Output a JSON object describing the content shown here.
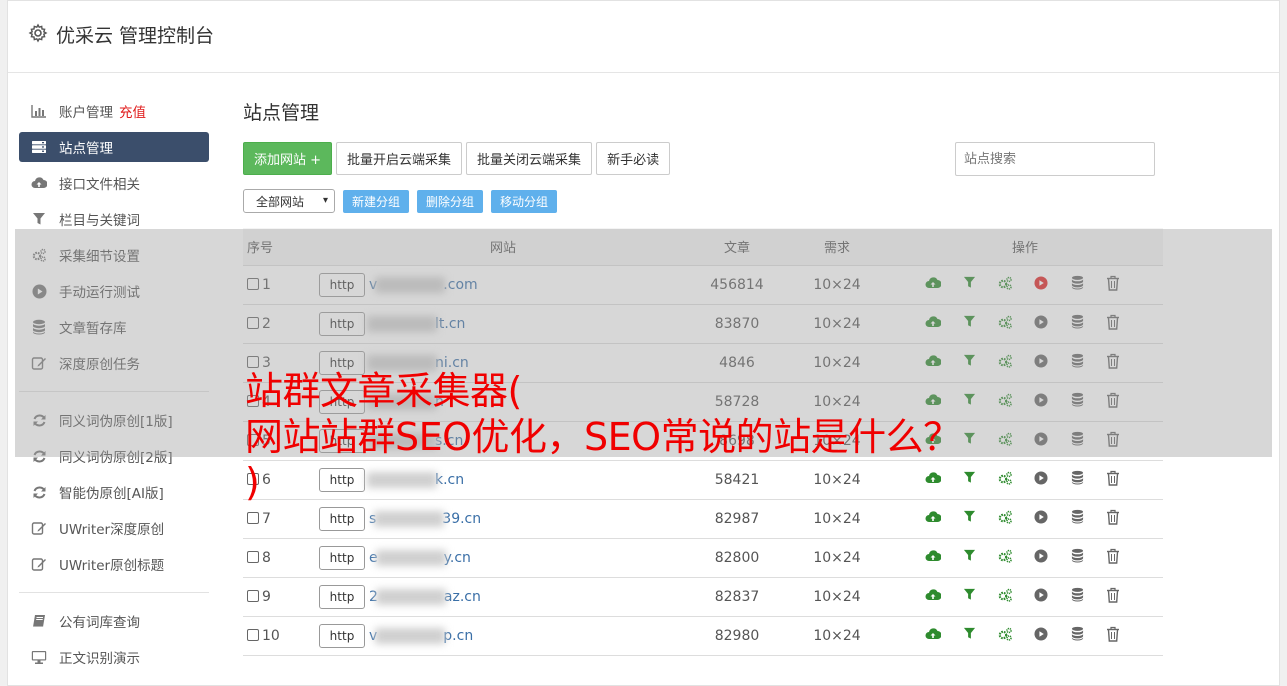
{
  "header": {
    "title": "优采云 管理控制台",
    "icon": "gear-icon"
  },
  "sidebar": {
    "groups": [
      [
        {
          "label": "账户管理",
          "badge": "充值",
          "icon": "bar-chart-icon"
        },
        {
          "label": "站点管理",
          "icon": "server-icon",
          "active": true
        },
        {
          "label": "接口文件相关",
          "icon": "cloud-upload-icon"
        },
        {
          "label": "栏目与关键词",
          "icon": "filter-icon"
        },
        {
          "label": "采集细节设置",
          "icon": "gears-icon"
        },
        {
          "label": "手动运行测试",
          "icon": "play-circle-icon"
        },
        {
          "label": "文章暂存库",
          "icon": "database-icon"
        },
        {
          "label": "深度原创任务",
          "icon": "edit-icon"
        }
      ],
      [
        {
          "label": "同义词伪原创[1版]",
          "icon": "refresh-icon"
        },
        {
          "label": "同义词伪原创[2版]",
          "icon": "refresh-icon"
        },
        {
          "label": "智能伪原创[AI版]",
          "icon": "refresh-icon"
        },
        {
          "label": "UWriter深度原创",
          "icon": "edit-icon"
        },
        {
          "label": "UWriter原创标题",
          "icon": "edit-icon"
        }
      ],
      [
        {
          "label": "公有词库查询",
          "icon": "book-icon"
        },
        {
          "label": "正文识别演示",
          "icon": "monitor-icon"
        }
      ]
    ]
  },
  "main": {
    "title": "站点管理",
    "buttons": {
      "add": "添加网站 +",
      "batch_open": "批量开启云端采集",
      "batch_close": "批量关闭云端采集",
      "guide": "新手必读"
    },
    "search_placeholder": "站点搜索",
    "group_select": "全部网站",
    "group_buttons": {
      "new": "新建分组",
      "delete": "删除分组",
      "move": "移动分组"
    },
    "table": {
      "headers": {
        "no": "序号",
        "site": "网站",
        "articles": "文章",
        "demand": "需求",
        "ops": "操作"
      },
      "http_label": "http",
      "rows": [
        {
          "no": "1",
          "pre": "v",
          "post": ".com",
          "articles": "456814",
          "demand": "10×24",
          "play_red": true
        },
        {
          "no": "2",
          "pre": "",
          "post": "lt.cn",
          "articles": "83870",
          "demand": "10×24",
          "play_red": false
        },
        {
          "no": "3",
          "pre": "",
          "post": "ni.cn",
          "articles": "4846",
          "demand": "10×24",
          "play_red": false
        },
        {
          "no": "4",
          "pre": "",
          "post": "n",
          "articles": "58728",
          "demand": "10×24",
          "play_red": false
        },
        {
          "no": "5",
          "pre": "",
          "post": "s.cn",
          "articles": "8698",
          "demand": "10×24",
          "play_red": false
        },
        {
          "no": "6",
          "pre": "",
          "post": "k.cn",
          "articles": "58421",
          "demand": "10×24",
          "play_red": false
        },
        {
          "no": "7",
          "pre": "s",
          "post": "39.cn",
          "articles": "82987",
          "demand": "10×24",
          "play_red": false
        },
        {
          "no": "8",
          "pre": "e",
          "post": "y.cn",
          "articles": "82800",
          "demand": "10×24",
          "play_red": false
        },
        {
          "no": "9",
          "pre": "2",
          "post": "az.cn",
          "articles": "82837",
          "demand": "10×24",
          "play_red": false
        },
        {
          "no": "10",
          "pre": "v",
          "post": "p.cn",
          "articles": "82980",
          "demand": "10×24",
          "play_red": false
        }
      ]
    }
  },
  "overlay": {
    "line1": "站群文章采集器(",
    "line2": "网站站群SEO优化，SEO常说的站是什么？",
    "line3": ")"
  },
  "colors": {
    "sidebar_active": "#3b4e6b",
    "accent_green": "#5cb85c",
    "link_blue": "#3a6fa7",
    "overlay_red": "#f00000",
    "recharge_red": "#e01b1b"
  }
}
